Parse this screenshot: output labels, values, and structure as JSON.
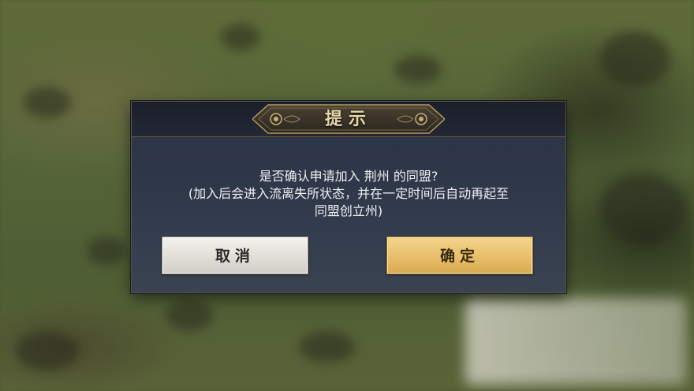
{
  "dialog": {
    "title": "提示",
    "message_line1": "是否确认申请加入 荆州 的同盟?",
    "message_line2": "(加入后会进入流离失所状态，并在一定时间后自动再起至",
    "message_line3": "同盟创立州)",
    "cancel_label": "取消",
    "confirm_label": "确定"
  },
  "colors": {
    "dialog_bg": "#2f3849",
    "title_text": "#e8d6a8",
    "cancel_button": "#e0ded6",
    "confirm_button": "#e8bf6b"
  }
}
